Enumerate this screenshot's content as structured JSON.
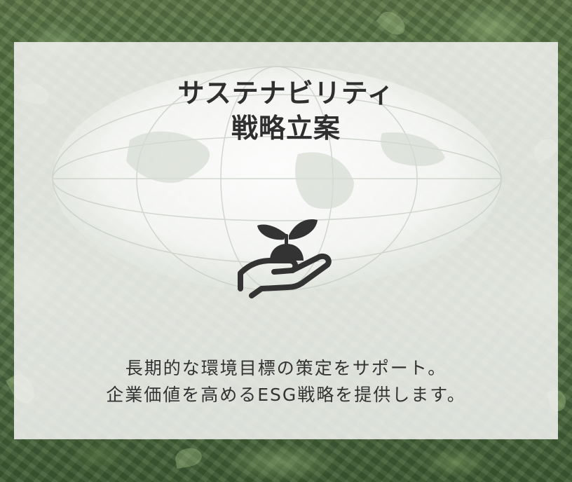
{
  "title": {
    "line1": "サステナビリティ",
    "line2": "戦略立案"
  },
  "icon": {
    "name": "sprout-in-hand-icon",
    "color": "#333333"
  },
  "description": {
    "line1": "長期的な環境目標の策定をサポート。",
    "line2": "企業価値を高めるESG戦略を提供します。"
  },
  "colors": {
    "card_background": "#f6f6f4",
    "text": "#333333"
  }
}
